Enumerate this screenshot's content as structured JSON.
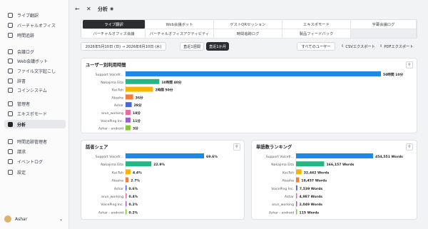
{
  "sidebar": {
    "items": [
      {
        "label": "ライブ翻訳",
        "icon": "live-translate-icon",
        "active": false
      },
      {
        "label": "バーチャルオフィス",
        "icon": "virtual-office-icon",
        "active": false
      },
      {
        "label": "時間追跡",
        "icon": "time-tracking-icon",
        "active": false
      },
      {
        "label": "会議ログ",
        "icon": "meeting-log-icon",
        "active": false
      },
      {
        "label": "Web会議ボット",
        "icon": "web-meeting-bot-icon",
        "active": false
      },
      {
        "label": "ファイル文字起こし",
        "icon": "file-transcription-icon",
        "active": false
      },
      {
        "label": "辞書",
        "icon": "dictionary-icon",
        "active": false
      },
      {
        "label": "コインシステム",
        "icon": "coin-system-icon",
        "active": false
      },
      {
        "label": "管理者",
        "icon": "admin-icon",
        "active": false
      },
      {
        "label": "エキスポモード",
        "icon": "expo-mode-icon",
        "active": false
      },
      {
        "label": "分析",
        "icon": "analytics-icon",
        "active": true
      },
      {
        "label": "時間追跡管理者",
        "icon": "time-tracking-admin-icon",
        "active": false
      },
      {
        "label": "請求",
        "icon": "billing-icon",
        "active": false
      },
      {
        "label": "イベントログ",
        "icon": "event-log-icon",
        "active": false
      },
      {
        "label": "設定",
        "icon": "settings-icon",
        "active": false
      }
    ],
    "user": {
      "name": "Ashar"
    }
  },
  "header": {
    "title": "分析"
  },
  "tabs": [
    {
      "label": "ライブ翻訳",
      "active": true
    },
    {
      "label": "Web会議ボット",
      "active": false
    },
    {
      "label": "ゲストQRセッション",
      "active": false
    },
    {
      "label": "エキスポモード",
      "active": false
    },
    {
      "label": "字幕会議ログ",
      "active": false
    },
    {
      "label": "バーチャルオフィス会議",
      "active": false
    },
    {
      "label": "バーチャルオフィスアクティビティ",
      "active": false
    },
    {
      "label": "時間追跡ログ",
      "active": false
    },
    {
      "label": "製品フィードバック",
      "active": false
    }
  ],
  "controls": {
    "date_range": "2026年5月10日 (日) → 2026年6月10日 (水)",
    "last_week": "直近1週間",
    "last_month": "直近1か月",
    "user_select": "すべてのユーザー",
    "csv_export": "CSVエクスポート",
    "pdf_export": "PDFエクスポート"
  },
  "charts": {
    "usage": {
      "title": "ユーザー別利用時間",
      "users": [
        "Support Voicefr...",
        "Nakajima Eita",
        "Kai-Teh",
        "Akasha",
        "Ashar",
        "arun_working",
        "VoicePing Inc.",
        "Ashar - android"
      ],
      "minutes": [
        1210,
        160,
        130,
        36,
        29,
        18,
        11,
        3
      ],
      "labels": [
        "50時間 10分",
        "10時間 40分",
        "2時間 50分",
        "36分",
        "29分",
        "18分",
        "11分",
        "3分"
      ],
      "colors": [
        "#1e88e5",
        "#26b686",
        "#f7b500",
        "#f07f3c",
        "#4a65d6",
        "#ec6b9b",
        "#9a62d0",
        "#8ac43f"
      ]
    },
    "share": {
      "title": "話者シェア",
      "users": [
        "Support Voicefr...",
        "Nakajima Eita",
        "Kai-Teh",
        "Akasha",
        "Ashar",
        "arun_working",
        "VoicePing Inc.",
        "Ashar - android"
      ],
      "values": [
        69.6,
        22.9,
        4.4,
        2.7,
        0.6,
        0.4,
        0.2,
        0.2
      ],
      "labels": [
        "69.6%",
        "22.9%",
        "4.4%",
        "2.7%",
        "0.6%",
        "0.4%",
        "0.2%",
        "0.2%"
      ],
      "colors": [
        "#1e88e5",
        "#26b686",
        "#f7b500",
        "#f07f3c",
        "#4a65d6",
        "#ec6b9b",
        "#9a62d0",
        "#8ac43f"
      ]
    },
    "words": {
      "title": "単語数ランキング",
      "users": [
        "Support Voicefr...",
        "Nakajima Eita",
        "Kai-Teh",
        "Akasha",
        "VoicePing Inc.",
        "Ashar",
        "arun_working",
        "Ashar - android"
      ],
      "values": [
        454551,
        166157,
        32442,
        18457,
        7539,
        4987,
        2049,
        115
      ],
      "labels": [
        "454,551 Words",
        "166,157 Words",
        "32,442 Words",
        "18,457 Words",
        "7,539 Words",
        "4,987 Words",
        "2,049 Words",
        "115 Words"
      ],
      "colors": [
        "#1e88e5",
        "#26b686",
        "#f7b500",
        "#f07f3c",
        "#4a65d6",
        "#ec6b9b",
        "#9a62d0",
        "#8ac43f"
      ]
    }
  },
  "chart_data": [
    {
      "type": "bar",
      "orientation": "horizontal",
      "title": "ユーザー別利用時間",
      "categories": [
        "Support Voicefr...",
        "Nakajima Eita",
        "Kai-Teh",
        "Akasha",
        "Ashar",
        "arun_working",
        "VoicePing Inc.",
        "Ashar - android"
      ],
      "values": [
        3010,
        640,
        170,
        36,
        29,
        18,
        11,
        3
      ],
      "unit": "分"
    },
    {
      "type": "bar",
      "orientation": "horizontal",
      "title": "話者シェア",
      "categories": [
        "Support Voicefr...",
        "Nakajima Eita",
        "Kai-Teh",
        "Akasha",
        "Ashar",
        "arun_working",
        "VoicePing Inc.",
        "Ashar - android"
      ],
      "values": [
        69.6,
        22.9,
        4.4,
        2.7,
        0.6,
        0.4,
        0.2,
        0.2
      ],
      "unit": "%"
    },
    {
      "type": "bar",
      "orientation": "horizontal",
      "title": "単語数ランキング",
      "categories": [
        "Support Voicefr...",
        "Nakajima Eita",
        "Kai-Teh",
        "Akasha",
        "VoicePing Inc.",
        "Ashar",
        "arun_working",
        "Ashar - android"
      ],
      "values": [
        454551,
        166157,
        32442,
        18457,
        7539,
        4987,
        2049,
        115
      ],
      "unit": "Words"
    }
  ]
}
